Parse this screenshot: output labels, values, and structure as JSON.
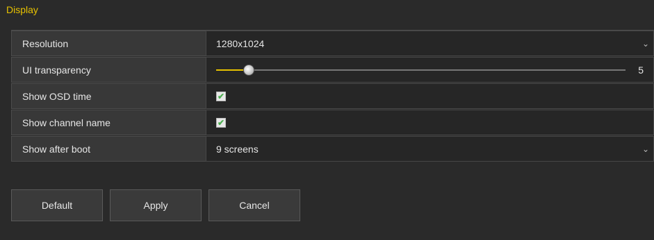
{
  "panel": {
    "title": "Display"
  },
  "settings": {
    "resolution": {
      "label": "Resolution",
      "value": "1280x1024",
      "icon": "chevron-down-icon"
    },
    "ui_transparency": {
      "label": "UI transparency",
      "value": "5",
      "level_fraction": 0.08
    },
    "show_osd_time": {
      "label": "Show OSD time",
      "checked": true
    },
    "show_channel_name": {
      "label": "Show channel name",
      "checked": true
    },
    "show_after_boot": {
      "label": "Show after boot",
      "value": "9 screens",
      "icon": "chevron-down-icon"
    }
  },
  "buttons": {
    "default": "Default",
    "apply": "Apply",
    "cancel": "Cancel"
  },
  "colors": {
    "accent": "#e8c200",
    "check": "#4caf50"
  }
}
